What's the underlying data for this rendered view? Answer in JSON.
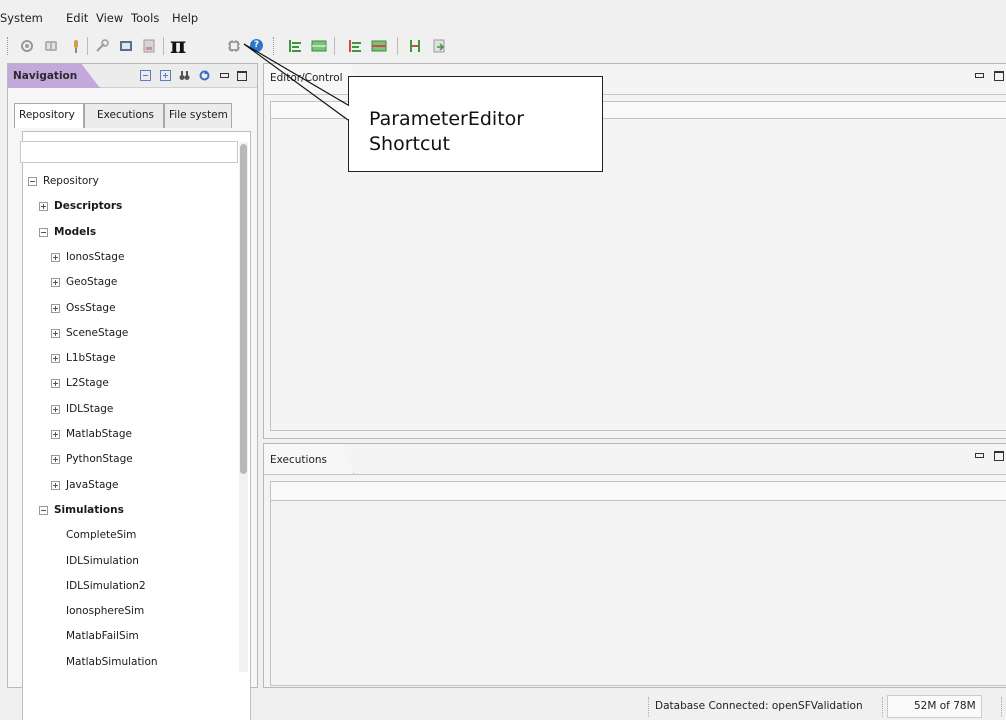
{
  "menubar": {
    "items": [
      "System",
      "Edit",
      "View",
      "Tools",
      "Help"
    ]
  },
  "toolbar": {
    "pi_glyph": "π",
    "help_glyph": "?",
    "icons": [
      "settings-icon",
      "database-icon",
      "pin-icon",
      "wrench-icon",
      "window-icon",
      "document-icon",
      "pi-icon",
      "chip-icon",
      "help-icon",
      "align-left-icon",
      "table-icon",
      "align-left-red-icon",
      "table-red-icon",
      "split-icon",
      "export-icon"
    ]
  },
  "navigation": {
    "title": "Navigation",
    "tabs": [
      "Repository",
      "Executions",
      "File system"
    ],
    "active_tab": "Repository",
    "search_value": "",
    "tree": [
      {
        "label": "Repository",
        "level": 0,
        "expander": "minus",
        "bold": false
      },
      {
        "label": "Descriptors",
        "level": 1,
        "expander": "plus",
        "bold": true
      },
      {
        "label": "Models",
        "level": 1,
        "expander": "minus",
        "bold": true
      },
      {
        "label": "IonosStage",
        "level": 2,
        "expander": "plus",
        "bold": false
      },
      {
        "label": "GeoStage",
        "level": 2,
        "expander": "plus",
        "bold": false
      },
      {
        "label": "OssStage",
        "level": 2,
        "expander": "plus",
        "bold": false
      },
      {
        "label": "SceneStage",
        "level": 2,
        "expander": "plus",
        "bold": false
      },
      {
        "label": "L1bStage",
        "level": 2,
        "expander": "plus",
        "bold": false
      },
      {
        "label": "L2Stage",
        "level": 2,
        "expander": "plus",
        "bold": false
      },
      {
        "label": "IDLStage",
        "level": 2,
        "expander": "plus",
        "bold": false
      },
      {
        "label": "MatlabStage",
        "level": 2,
        "expander": "plus",
        "bold": false
      },
      {
        "label": "PythonStage",
        "level": 2,
        "expander": "plus",
        "bold": false
      },
      {
        "label": "JavaStage",
        "level": 2,
        "expander": "plus",
        "bold": false
      },
      {
        "label": "Simulations",
        "level": 1,
        "expander": "minus",
        "bold": true
      },
      {
        "label": "CompleteSim",
        "level": 2,
        "expander": "none",
        "bold": false
      },
      {
        "label": "IDLSimulation",
        "level": 2,
        "expander": "none",
        "bold": false
      },
      {
        "label": "IDLSimulation2",
        "level": 2,
        "expander": "none",
        "bold": false
      },
      {
        "label": "IonosphereSim",
        "level": 2,
        "expander": "none",
        "bold": false
      },
      {
        "label": "MatlabFailSim",
        "level": 2,
        "expander": "none",
        "bold": false
      },
      {
        "label": "MatlabSimulation",
        "level": 2,
        "expander": "none",
        "bold": false
      }
    ]
  },
  "editor": {
    "title": "Editor/Control"
  },
  "executions": {
    "title": "Executions"
  },
  "callout": {
    "line1": "ParameterEditor",
    "line2": "Shortcut"
  },
  "status": {
    "db_text": "Database Connected: openSFValidation",
    "memory_text": "52M of 78M"
  },
  "colors": {
    "nav_tab": "#c3a8db",
    "background": "#f0f0f0"
  }
}
